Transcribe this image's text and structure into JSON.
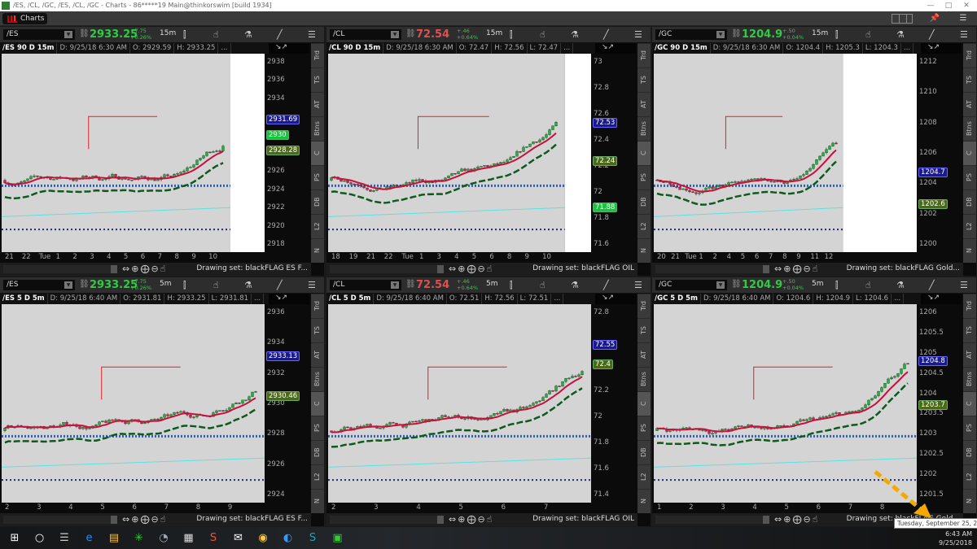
{
  "window": {
    "title": "/ES, /CL, /GC, /ES, /CL, /GC - Charts - 86*****19 Main@thinkorswim [build 1934]",
    "controls": [
      "—",
      "□",
      "✕"
    ]
  },
  "tabbar": {
    "tab_label": "Charts",
    "icons": [
      "grid-layout-icon",
      "pin-icon",
      "menu-icon"
    ]
  },
  "colors": {
    "up": "#2ecc40",
    "down": "#e05050",
    "last_price_marker": "#1a1a8c",
    "level_marker": "#4a6a18",
    "green_marker": "#17c43f",
    "annotation_arrow": "#f4a900"
  },
  "side_tabs": [
    "Trd",
    "TS",
    "AT",
    "Btns",
    "C",
    "PS",
    "DB",
    "L2",
    "N"
  ],
  "selected_side_tab": "C",
  "panels": [
    {
      "symbol": "/ES",
      "price": "2933.25",
      "direction": "up",
      "change": "+7.75",
      "change_pct": "+0.26%",
      "timeframe": "15m",
      "info": [
        "/ES 90 D 15m",
        "D: 9/25/18 6:30 AM",
        "O: 2929.59",
        "H: 2933.25",
        "..."
      ],
      "y_ticks": [
        2938,
        2936,
        2934,
        2932,
        2930,
        2928,
        2926,
        2924,
        2922,
        2920,
        2918
      ],
      "y_tick_labels": [
        "2938",
        "2936",
        "2934",
        "",
        "",
        "",
        "2926",
        "2924",
        "2922",
        "2920",
        "2918"
      ],
      "markers": [
        {
          "value": 2931.69,
          "label": "2931.69",
          "kind": "last"
        },
        {
          "value": 2930,
          "label": "2930",
          "kind": "green"
        },
        {
          "value": 2928.28,
          "label": "2928.28",
          "kind": "level"
        }
      ],
      "x_labels": [
        "21",
        "22",
        "Tue",
        "1",
        "2",
        "3",
        "4",
        "5",
        "6",
        "7",
        "8",
        "9",
        "10"
      ],
      "future_fraction": 0.13,
      "drawing_set": "Drawing set: blackFLAG ES F..."
    },
    {
      "symbol": "/CL",
      "price": "72.54",
      "direction": "down",
      "change": "+.46",
      "change_pct": "+0.64%",
      "timeframe": "15m",
      "info": [
        "/CL 90 D 15m",
        "D: 9/25/18 6:30 AM",
        "O: 72.47",
        "H: 72.56",
        "L: 72.47",
        "..."
      ],
      "y_ticks": [
        73,
        72.8,
        72.6,
        72.4,
        72.2,
        72,
        71.8,
        71.6
      ],
      "y_tick_labels": [
        "73",
        "72.8",
        "72.6",
        "72.4",
        "72.2",
        "72",
        "71.8",
        "71.6"
      ],
      "markers": [
        {
          "value": 72.53,
          "label": "72.53",
          "kind": "last"
        },
        {
          "value": 72.24,
          "label": "72.24",
          "kind": "level"
        },
        {
          "value": 71.88,
          "label": "71.88",
          "kind": "green"
        }
      ],
      "x_labels": [
        "18",
        "19",
        "21",
        "22",
        "Tue",
        "1",
        "3",
        "4",
        "5",
        "6",
        "8",
        "9",
        "10"
      ],
      "future_fraction": 0.1,
      "drawing_set": "Drawing set: blackFLAG OIL"
    },
    {
      "symbol": "/GC",
      "price": "1204.9",
      "direction": "up",
      "change": "+.50",
      "change_pct": "+0.04%",
      "timeframe": "15m",
      "info": [
        "/GC 90 D 15m",
        "D: 9/25/18 6:30 AM",
        "O: 1204.4",
        "H: 1205.3",
        "L: 1204.3",
        "..."
      ],
      "y_ticks": [
        1212,
        1210,
        1208,
        1206,
        1204,
        1202,
        1200
      ],
      "y_tick_labels": [
        "1212",
        "1210",
        "1208",
        "1206",
        "1204",
        "1202",
        "1200"
      ],
      "markers": [
        {
          "value": 1204.7,
          "label": "1204.7",
          "kind": "last"
        },
        {
          "value": 1202.6,
          "label": "1202.6",
          "kind": "level"
        }
      ],
      "x_labels": [
        "20",
        "21",
        "Tue",
        "1",
        "2",
        "4",
        "5",
        "6",
        "7",
        "8",
        "9",
        "11",
        "12"
      ],
      "future_fraction": 0.28,
      "drawing_set": "Drawing set: blackFLAG Gold..."
    },
    {
      "symbol": "/ES",
      "price": "2933.25",
      "direction": "up",
      "change": "+7.75",
      "change_pct": "+0.26%",
      "timeframe": "5m",
      "info": [
        "/ES 5 D 5m",
        "D: 9/25/18 6:40 AM",
        "O: 2931.81",
        "H: 2933.25",
        "L: 2931.81",
        "..."
      ],
      "y_ticks": [
        2936,
        2934,
        2932,
        2930,
        2928,
        2926,
        2924
      ],
      "y_tick_labels": [
        "2936",
        "2934",
        "2932",
        "2930",
        "2928",
        "2926",
        "2924"
      ],
      "markers": [
        {
          "value": 2933.13,
          "label": "2933.13",
          "kind": "last"
        },
        {
          "value": 2930.46,
          "label": "2930.46",
          "kind": "level"
        }
      ],
      "x_labels": [
        "2",
        "3",
        "4",
        "5",
        "6",
        "7",
        "8",
        "9"
      ],
      "future_fraction": 0,
      "drawing_set": "Drawing set: blackFLAG ES F..."
    },
    {
      "symbol": "/CL",
      "price": "72.54",
      "direction": "down",
      "change": "+.46",
      "change_pct": "+0.64%",
      "timeframe": "5m",
      "info": [
        "/CL 5 D 5m",
        "D: 9/25/18 6:40 AM",
        "O: 72.51",
        "H: 72.56",
        "L: 72.51",
        "..."
      ],
      "y_ticks": [
        72.8,
        72.6,
        72.4,
        72.2,
        72,
        71.8,
        71.6,
        71.4
      ],
      "y_tick_labels": [
        "72.8",
        "",
        "",
        "72.2",
        "72",
        "71.8",
        "71.6",
        "71.4"
      ],
      "markers": [
        {
          "value": 72.55,
          "label": "72.55",
          "kind": "last"
        },
        {
          "value": 72.4,
          "label": "72.4",
          "kind": "level"
        }
      ],
      "x_labels": [
        "2",
        "3",
        "4",
        "5",
        "6",
        "7"
      ],
      "future_fraction": 0,
      "drawing_set": "Drawing set: blackFLAG OIL"
    },
    {
      "symbol": "/GC",
      "price": "1204.9",
      "direction": "up",
      "change": "+.50",
      "change_pct": "+0.04%",
      "timeframe": "5m",
      "info": [
        "/GC 5 D 5m",
        "D: 9/25/18 6:40 AM",
        "O: 1204.6",
        "H: 1204.9",
        "L: 1204.6",
        "..."
      ],
      "y_ticks": [
        1206,
        1205.5,
        1205,
        1204.5,
        1204,
        1203.5,
        1203,
        1202.5,
        1202,
        1201.5
      ],
      "y_tick_labels": [
        "1206",
        "1205.5",
        "1205",
        "1204.5",
        "1204",
        "1203.5",
        "1203",
        "1202.5",
        "1202",
        "1201.5"
      ],
      "markers": [
        {
          "value": 1204.8,
          "label": "1204.8",
          "kind": "last"
        },
        {
          "value": 1203.7,
          "label": "1203.7",
          "kind": "level"
        }
      ],
      "x_labels": [
        "1",
        "2",
        "3",
        "4",
        "5",
        "6",
        "7",
        "8"
      ],
      "future_fraction": 0,
      "drawing_set": "Drawing set: blackFLAG Gold..."
    }
  ],
  "taskbar": {
    "icons": [
      "windows-start-icon",
      "cortana-icon",
      "task-view-icon",
      "edge-icon",
      "file-explorer-icon",
      "thinkorswim-icon",
      "app-icon",
      "calculator-icon",
      "snagit-icon",
      "mail-icon",
      "chrome-icon",
      "app-icon-2",
      "skype-icon",
      "app-icon-3"
    ],
    "time": "6:43 AM",
    "date": "9/25/2018",
    "tooltip": "Tuesday, September 25, 2018"
  }
}
